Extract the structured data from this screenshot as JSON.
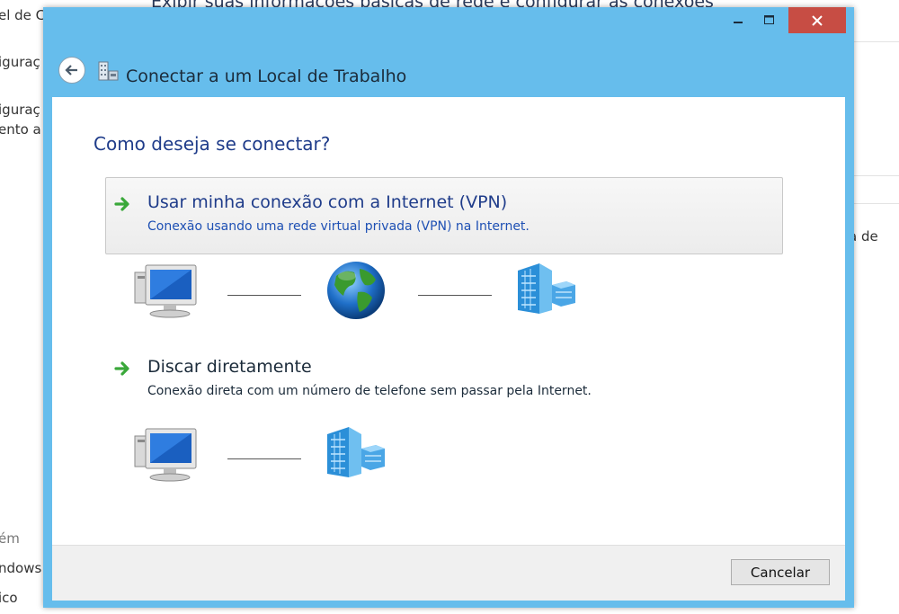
{
  "background": {
    "header_fragment": "Exibir suas informações básicas de rede e configurar as conexões",
    "left_items": [
      "el de Co",
      "iguraç",
      "iguraç",
      "ento a"
    ],
    "right_fragment": "a de",
    "bottom_items": [
      "ém",
      "ndows",
      "ico"
    ]
  },
  "dialog": {
    "title": "Conectar a um Local de Trabalho",
    "heading": "Como deseja se conectar?",
    "options": [
      {
        "title": "Usar minha conexão com a Internet (VPN)",
        "description": "Conexão usando uma rede virtual privada (VPN) na Internet."
      },
      {
        "title": "Discar diretamente",
        "description": "Conexão direta com um número de telefone sem passar pela Internet."
      }
    ],
    "cancel_label": "Cancelar"
  },
  "icons": {
    "back": "back-arrow-icon",
    "option_arrow": "green-arrow-icon",
    "computer": "computer-icon",
    "globe": "globe-icon",
    "building": "building-icon"
  },
  "colors": {
    "window_frame": "#66bdec",
    "close_button": "#c74d44",
    "heading_blue": "#1f3c8a",
    "link_blue": "#1e50b4",
    "arrow_green": "#3aa83a"
  }
}
